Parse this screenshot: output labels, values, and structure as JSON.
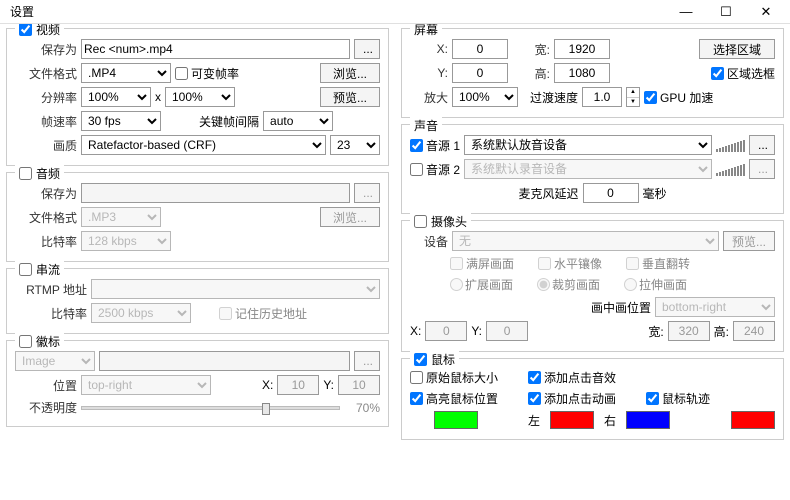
{
  "window": {
    "title": "设置",
    "minimize": "—",
    "maximize": "☐",
    "close": "✕"
  },
  "video": {
    "title": "视频",
    "save_as_label": "保存为",
    "save_as_value": "Rec <num>.mp4",
    "dots": "...",
    "format_label": "文件格式",
    "format_value": ".MP4",
    "vbr_label": "可变帧率",
    "browse": "浏览...",
    "res_label": "分辨率",
    "res_w": "100%",
    "res_x": "x",
    "res_h": "100%",
    "preview": "预览...",
    "fps_label": "帧速率",
    "fps_value": "30 fps",
    "keyframe_label": "关键帧间隔",
    "keyframe_value": "auto",
    "quality_label": "画质",
    "quality_mode": "Ratefactor-based (CRF)",
    "quality_value": "23"
  },
  "audio": {
    "title": "音频",
    "save_as_label": "保存为",
    "save_as_value": "",
    "dots": "...",
    "format_label": "文件格式",
    "format_value": ".MP3",
    "browse": "浏览...",
    "bitrate_label": "比特率",
    "bitrate_value": "128 kbps"
  },
  "stream": {
    "title": "串流",
    "rtmp_label": "RTMP 地址",
    "rtmp_value": "",
    "bitrate_label": "比特率",
    "bitrate_value": "2500 kbps",
    "remember_label": "记住历史地址"
  },
  "emblem": {
    "title": "徽标",
    "type": "Image",
    "dots": "...",
    "pos_label": "位置",
    "pos_value": "top-right",
    "x_label": "X:",
    "x_value": "10",
    "y_label": "Y:",
    "y_value": "10",
    "opacity_label": "不透明度",
    "opacity_pct": "70%"
  },
  "screen": {
    "title": "屏幕",
    "x_label": "X:",
    "x_value": "0",
    "y_label": "Y:",
    "y_value": "0",
    "w_label": "宽:",
    "w_value": "1920",
    "h_label": "高:",
    "h_value": "1080",
    "select_region": "选择区域",
    "region_frame": "区域选框",
    "zoom_label": "放大",
    "zoom_value": "100%",
    "speed_label": "过渡速度",
    "speed_value": "1.0",
    "gpu_label": "GPU 加速"
  },
  "sound": {
    "title": "声音",
    "src1_label": "音源 1",
    "src1_value": "系统默认放音设备",
    "src2_label": "音源 2",
    "src2_value": "系统默认录音设备",
    "mic_delay_label": "麦克风延迟",
    "mic_delay_value": "0",
    "mic_delay_unit": "毫秒",
    "dots": "..."
  },
  "camera": {
    "title": "摄像头",
    "device_label": "设备",
    "device_value": "无",
    "preview": "预览...",
    "full_label": "满屏画面",
    "mirror_label": "水平镶像",
    "vflip_label": "垂直翻转",
    "extend_label": "扩展画面",
    "crop_label": "裁剪画面",
    "stretch_label": "拉伸画面",
    "pip_pos_label": "画中画位置",
    "pip_pos_value": "bottom-right",
    "x_label": "X:",
    "x_value": "0",
    "y_label": "Y:",
    "y_value": "0",
    "w_label": "宽:",
    "w_value": "320",
    "h_label": "高:",
    "h_value": "240"
  },
  "mouse": {
    "title": "鼠标",
    "orig_size": "原始鼠标大小",
    "click_sound": "添加点击音效",
    "highlight": "高亮鼠标位置",
    "click_anim": "添加点击动画",
    "trail": "鼠标轨迹",
    "left": "左",
    "right": "右",
    "colors": {
      "highlight": "#00ff00",
      "left": "#ff0000",
      "right": "#0000ff",
      "trail": "#ff0000"
    }
  }
}
